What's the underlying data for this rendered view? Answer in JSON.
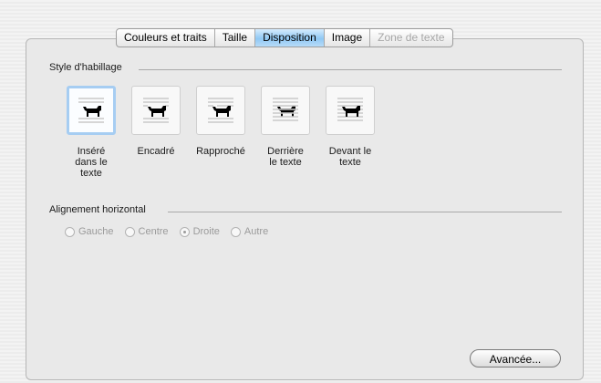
{
  "tabs": [
    {
      "label": "Couleurs et traits",
      "state": "normal"
    },
    {
      "label": "Taille",
      "state": "normal"
    },
    {
      "label": "Disposition",
      "state": "selected"
    },
    {
      "label": "Image",
      "state": "normal"
    },
    {
      "label": "Zone de texte",
      "state": "disabled"
    }
  ],
  "wrap_section": {
    "label": "Style d'habillage",
    "options": [
      {
        "label": "Inséré\ndans le\ntexte",
        "icon": "inline-dog-icon",
        "selected": true
      },
      {
        "label": "Encadré",
        "icon": "square-dog-icon",
        "selected": false
      },
      {
        "label": "Rapproché",
        "icon": "tight-dog-icon",
        "selected": false
      },
      {
        "label": "Derrière\nle texte",
        "icon": "behind-text-dog-icon",
        "selected": false
      },
      {
        "label": "Devant le\ntexte",
        "icon": "in-front-dog-icon",
        "selected": false
      }
    ]
  },
  "alignment_section": {
    "label": "Alignement horizontal",
    "options": [
      {
        "label": "Gauche",
        "checked": false
      },
      {
        "label": "Centre",
        "checked": false
      },
      {
        "label": "Droite",
        "checked": true
      },
      {
        "label": "Autre",
        "checked": false
      }
    ],
    "enabled": false
  },
  "advanced_button": {
    "label": "Avancée..."
  },
  "colors": {
    "selected_tab": "#8fc8f4",
    "selected_option_border": "#a6cdf2",
    "disabled_text": "#9b9b9b"
  }
}
